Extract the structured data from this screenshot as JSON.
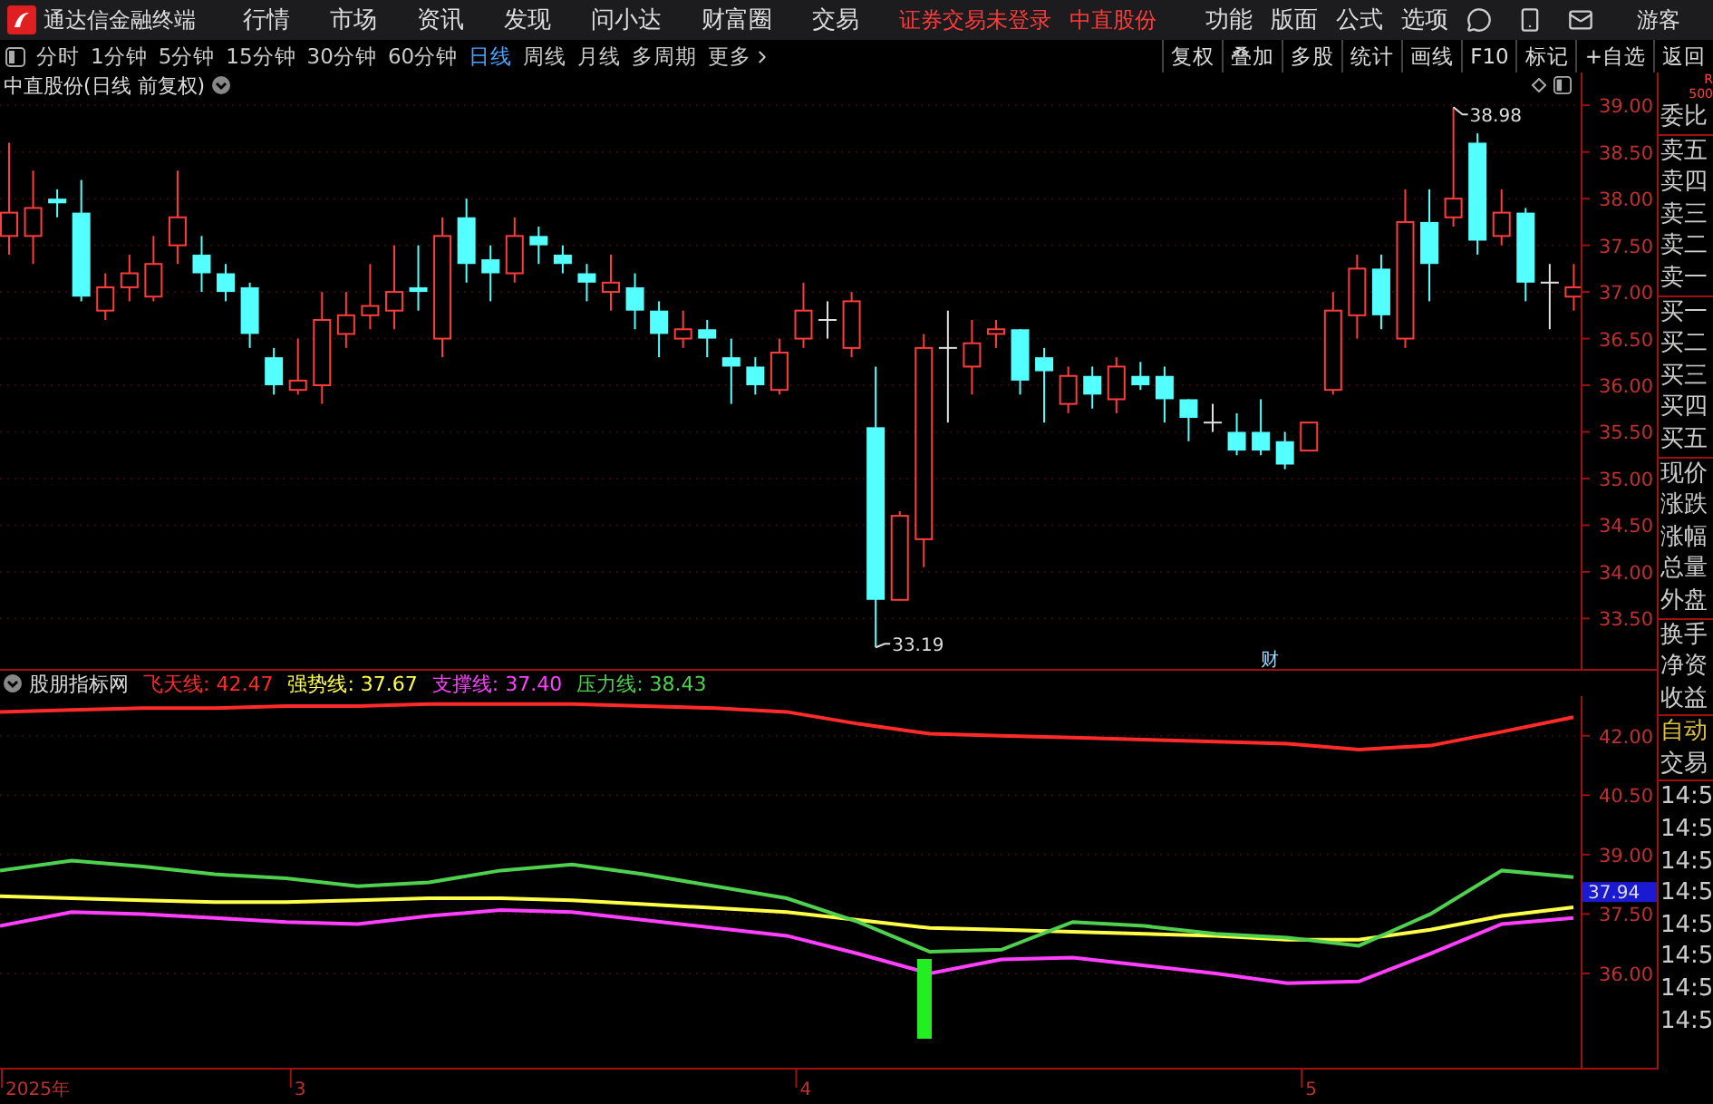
{
  "app": {
    "title": "通达信金融终端"
  },
  "menu": [
    "行情",
    "市场",
    "资讯",
    "发现",
    "问小达",
    "财富圈",
    "交易"
  ],
  "login_status": "证券交易未登录",
  "stock": "中直股份",
  "right_menu": [
    "功能",
    "版面",
    "公式",
    "选项"
  ],
  "user": "游客",
  "periods": [
    {
      "label": "分时",
      "selected": false
    },
    {
      "label": "1分钟",
      "selected": false
    },
    {
      "label": "5分钟",
      "selected": false
    },
    {
      "label": "15分钟",
      "selected": false
    },
    {
      "label": "30分钟",
      "selected": false
    },
    {
      "label": "60分钟",
      "selected": false
    },
    {
      "label": "日线",
      "selected": true
    },
    {
      "label": "周线",
      "selected": false
    },
    {
      "label": "月线",
      "selected": false
    },
    {
      "label": "多周期",
      "selected": false
    },
    {
      "label": "更多",
      "selected": false
    }
  ],
  "tools": [
    "复权",
    "叠加",
    "多股",
    "统计",
    "画线",
    "F10",
    "标记",
    "+自选",
    "返回"
  ],
  "chart": {
    "title": "中直股份(日线 前复权)",
    "marker": "财",
    "high_label": "38.98",
    "low_label": "33.19",
    "price_axis": [
      "39.00",
      "38.50",
      "38.00",
      "37.50",
      "37.00",
      "36.50",
      "36.00",
      "35.50",
      "35.00",
      "34.50",
      "34.00",
      "33.50"
    ],
    "date_axis": [
      "2025年",
      "3",
      "4",
      "5"
    ]
  },
  "indicator": {
    "name": "股朋指标网",
    "current_label": "37.94",
    "legend": [
      {
        "label": "飞天线: 42.47",
        "color": "#ff2a2a"
      },
      {
        "label": "强势线: 37.67",
        "color": "#ffff4a"
      },
      {
        "label": "支撑线: 37.40",
        "color": "#ff40ff"
      },
      {
        "label": "压力线: 38.43",
        "color": "#4fd04f"
      }
    ],
    "chart_data": {
      "type": "line",
      "grid": true,
      "ylim": [
        33.62,
        43.0
      ],
      "yticks": [
        {
          "value": 36,
          "label": "36.00"
        },
        {
          "value": 37.5,
          "label": "37.50"
        },
        {
          "value": 39,
          "label": "39.00"
        },
        {
          "value": 40.5,
          "label": "40.50"
        },
        {
          "value": 42,
          "label": "42.00"
        }
      ],
      "series": [
        {
          "color": "#ff2a2a",
          "values": [
            42.6,
            42.65,
            42.7,
            42.7,
            42.75,
            42.75,
            42.8,
            42.8,
            42.8,
            42.75,
            42.7,
            42.6,
            42.3,
            42.05,
            42.0,
            41.95,
            41.9,
            41.85,
            41.8,
            41.65,
            41.75,
            42.1,
            42.47
          ]
        },
        {
          "color": "#ffff4a",
          "values": [
            37.95,
            37.9,
            37.85,
            37.8,
            37.8,
            37.85,
            37.9,
            37.9,
            37.85,
            37.75,
            37.65,
            37.55,
            37.35,
            37.15,
            37.1,
            37.05,
            37.0,
            36.95,
            36.85,
            36.85,
            37.1,
            37.45,
            37.67
          ]
        },
        {
          "color": "#ff40ff",
          "values": [
            37.2,
            37.55,
            37.5,
            37.4,
            37.3,
            37.25,
            37.45,
            37.6,
            37.55,
            37.35,
            37.15,
            36.95,
            36.5,
            36.0,
            36.35,
            36.4,
            36.2,
            36.0,
            35.75,
            35.8,
            36.5,
            37.25,
            37.4
          ]
        },
        {
          "color": "#4fd04f",
          "values": [
            38.6,
            38.85,
            38.7,
            38.5,
            38.4,
            38.2,
            38.3,
            38.6,
            38.75,
            38.5,
            38.2,
            37.9,
            37.3,
            36.55,
            36.6,
            37.3,
            37.2,
            37.0,
            36.9,
            36.7,
            37.5,
            38.6,
            38.43
          ]
        }
      ]
    }
  },
  "side_panel": {
    "corner": [
      "R",
      "500"
    ],
    "groups": [
      [
        "委比"
      ],
      [
        "卖五",
        "卖四",
        "卖三",
        "卖二",
        "卖一"
      ],
      [
        "买一",
        "买二",
        "买三",
        "买四",
        "买五"
      ],
      [
        "现价",
        "涨跌",
        "涨幅",
        "总量",
        "外盘"
      ],
      [
        "换手",
        "净资",
        "收益"
      ]
    ],
    "mode": "自动",
    "trade_title": "交易",
    "times": [
      "14:5",
      "14:5",
      "14:5",
      "14:5",
      "14:5",
      "14:5",
      "14:5",
      "14:5"
    ]
  }
}
